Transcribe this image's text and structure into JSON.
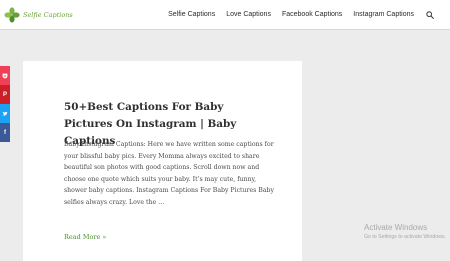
{
  "site": {
    "logo_text": "Selfie Captions"
  },
  "nav": {
    "items": [
      {
        "label": "Selfie Captions"
      },
      {
        "label": "Love Captions"
      },
      {
        "label": "Facebook Captions"
      },
      {
        "label": "Instagram Captions"
      }
    ],
    "search_icon": "search-icon"
  },
  "share": {
    "buttons": [
      {
        "icon": "pocket-icon",
        "glyph": "",
        "color": "#ef4056"
      },
      {
        "icon": "pinterest-icon",
        "glyph": "P",
        "color": "#cb2027"
      },
      {
        "icon": "twitter-icon",
        "glyph": "",
        "color": "#1da1f2"
      },
      {
        "icon": "facebook-icon",
        "glyph": "f",
        "color": "#3b5998"
      }
    ]
  },
  "post": {
    "title": "50+Best Captions For Baby Pictures On Instagram | Baby Captions",
    "excerpt": "Baby Instagram Captions: Here we have written some captions for your blissful baby pics. Every Momma always excited to share beautiful son photos with good captions. Scroll down now and choose one quote which suits your baby. It’s may cute, funny, shower baby captions. Instagram Captions For Baby Pictures Baby selfies always crazy. Love the …",
    "read_more": "Read More »"
  },
  "watermark": {
    "title": "Activate Windows",
    "subtitle": "Go to Settings to activate Windows."
  },
  "colors": {
    "brand_green": "#6aa33c",
    "link_green": "#4f9134"
  }
}
